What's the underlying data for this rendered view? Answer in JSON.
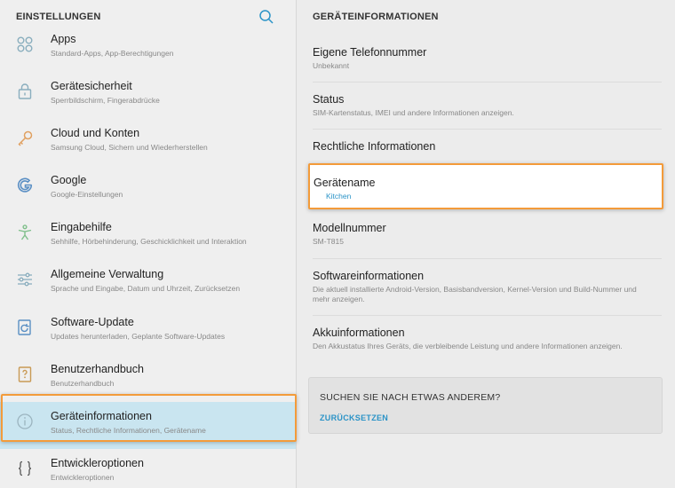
{
  "left_header": {
    "title": "EINSTELLUNGEN",
    "search_icon": "search-icon"
  },
  "menu": [
    {
      "title": "Apps",
      "subtitle": "Standard-Apps, App-Berechtigungen",
      "icon": "apps-icon"
    },
    {
      "title": "Gerätesicherheit",
      "subtitle": "Sperrbildschirm, Fingerabdrücke",
      "icon": "lock-icon"
    },
    {
      "title": "Cloud und Konten",
      "subtitle": "Samsung Cloud, Sichern und Wiederherstellen",
      "icon": "key-icon"
    },
    {
      "title": "Google",
      "subtitle": "Google-Einstellungen",
      "icon": "google-icon"
    },
    {
      "title": "Eingabehilfe",
      "subtitle": "Sehhilfe, Hörbehinderung, Geschicklichkeit und Interaktion",
      "icon": "accessibility-icon"
    },
    {
      "title": "Allgemeine Verwaltung",
      "subtitle": "Sprache und Eingabe, Datum und Uhrzeit, Zurücksetzen",
      "icon": "sliders-icon"
    },
    {
      "title": "Software-Update",
      "subtitle": "Updates herunterladen, Geplante Software-Updates",
      "icon": "update-icon"
    },
    {
      "title": "Benutzerhandbuch",
      "subtitle": "Benutzerhandbuch",
      "icon": "manual-icon"
    },
    {
      "title": "Geräteinformationen",
      "subtitle": "Status, Rechtliche Informationen, Gerätename",
      "icon": "info-icon",
      "selected": true
    },
    {
      "title": "Entwickleroptionen",
      "subtitle": "Entwickleroptionen",
      "icon": "code-braces-icon"
    }
  ],
  "right_header": {
    "title": "GERÄTEINFORMATIONEN"
  },
  "info": [
    {
      "title": "Eigene Telefonnummer",
      "subtitle": "Unbekannt"
    },
    {
      "title": "Status",
      "subtitle": "SIM-Kartenstatus, IMEI und andere Informationen anzeigen."
    },
    {
      "title": "Rechtliche Informationen",
      "subtitle": ""
    },
    {
      "title": "Gerätename",
      "subtitle": "Kitchen",
      "highlighted": true
    },
    {
      "title": "Modellnummer",
      "subtitle": "SM-T815"
    },
    {
      "title": "Softwareinformationen",
      "subtitle": "Die aktuell installierte Android-Version, Basisbandversion, Kernel-Version und Build-Nummer und mehr anzeigen."
    },
    {
      "title": "Akkuinformationen",
      "subtitle": "Den Akkustatus Ihres Geräts, die verbleibende Leistung und andere Informationen anzeigen."
    }
  ],
  "search_card": {
    "question": "SUCHEN SIE NACH ETWAS ANDEREM?",
    "reset": "ZURÜCKSETZEN"
  },
  "colors": {
    "accent": "#2a93c7",
    "icon": "#8aaebe",
    "selected_bg": "#c9e5f0",
    "highlight_border": "#f39b3a"
  }
}
